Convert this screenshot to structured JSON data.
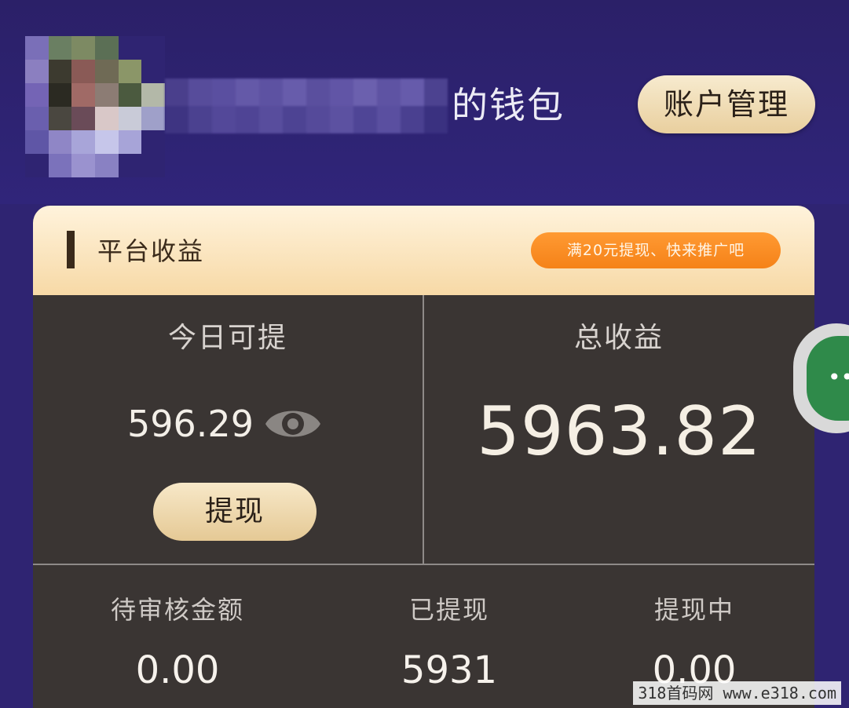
{
  "header": {
    "wallet_title": "的钱包",
    "account_button": "账户管理"
  },
  "card": {
    "title": "平台收益",
    "promo": "满20元提现、快来推广吧",
    "today": {
      "label": "今日可提",
      "value": "596.29",
      "withdraw_button": "提现",
      "visibility_icon": "eye-icon"
    },
    "total": {
      "label": "总收益",
      "value": "5963.82"
    },
    "stats": [
      {
        "label": "待审核金额",
        "value": "0.00"
      },
      {
        "label": "已提现",
        "value": "5931"
      },
      {
        "label": "提现中",
        "value": "0.00"
      }
    ]
  },
  "floating_widget": {
    "icon": "more-dots-icon",
    "glyph": "••"
  },
  "watermark": "318首码网  www.e318.com",
  "colors": {
    "background": "#2f2472",
    "card_dark": "#3a3533",
    "gold_button": "#e9cf9e",
    "promo_orange": "#f58218"
  }
}
